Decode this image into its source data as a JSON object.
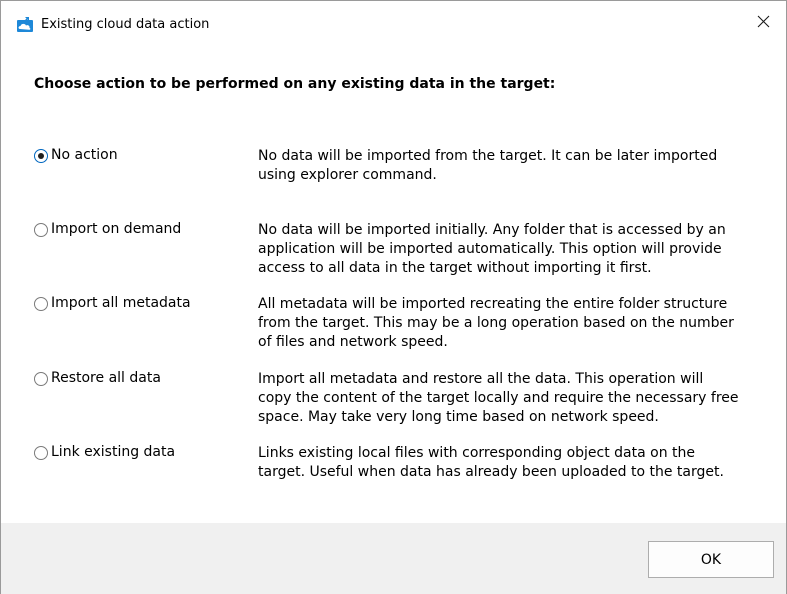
{
  "window": {
    "title": "Existing cloud data action",
    "icon": "cloud-app-icon",
    "accent_color": "#0067c0",
    "footer_color": "#f0f0f0"
  },
  "heading": "Choose action to be performed on any existing data in the target:",
  "options": [
    {
      "label": "No action",
      "checked": true,
      "description": "No data will be imported from the target. It can be later imported\nusing explorer command."
    },
    {
      "label": "Import on demand",
      "checked": false,
      "description": "No data will be imported initially. Any folder that is accessed by an\napplication will be imported automatically. This option will provide\naccess to all data in the target without importing it first."
    },
    {
      "label": "Import all metadata",
      "checked": false,
      "description": "All metadata will be imported recreating the entire folder structure\nfrom the target. This may be a long operation based on the number\nof files and network speed."
    },
    {
      "label": "Restore all data",
      "checked": false,
      "description": "Import all metadata and restore all the data. This operation will\ncopy the content of the target locally and require the necessary free\nspace. May take very long time based on network speed."
    },
    {
      "label": "Link existing data",
      "checked": false,
      "description": "Links existing local files with corresponding object data on the\ntarget. Useful when data has already been uploaded to the target."
    }
  ],
  "buttons": {
    "ok_label": "OK"
  }
}
